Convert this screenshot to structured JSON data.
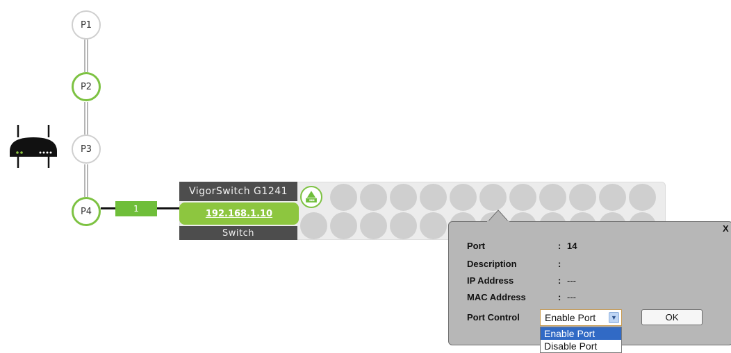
{
  "topology": {
    "nodes": [
      {
        "label": "P1",
        "active": false
      },
      {
        "label": "P2",
        "active": true
      },
      {
        "label": "P3",
        "active": false
      },
      {
        "label": "P4",
        "active": true
      }
    ],
    "link_port": "1"
  },
  "switch": {
    "name": "VigorSwitch G1241",
    "ip": "192.168.1.10",
    "type": "Switch"
  },
  "popup": {
    "close_label": "X",
    "port_label": "Port",
    "port_value": "14",
    "description_label": "Description",
    "description_value": "",
    "ip_label": "IP Address",
    "ip_value": "---",
    "mac_label": "MAC Address",
    "mac_value": "---",
    "control_label": "Port Control",
    "control_selected": "Enable Port",
    "control_options": [
      "Enable Port",
      "Disable Port"
    ],
    "ok_label": "OK"
  },
  "colors": {
    "active_green": "#7dc242",
    "ip_green": "#8dc63f",
    "dark_label": "#4d4d4d",
    "port_gray": "#cfcfcf",
    "popup_gray": "#b7b7b7",
    "selection_blue": "#316ac5"
  }
}
